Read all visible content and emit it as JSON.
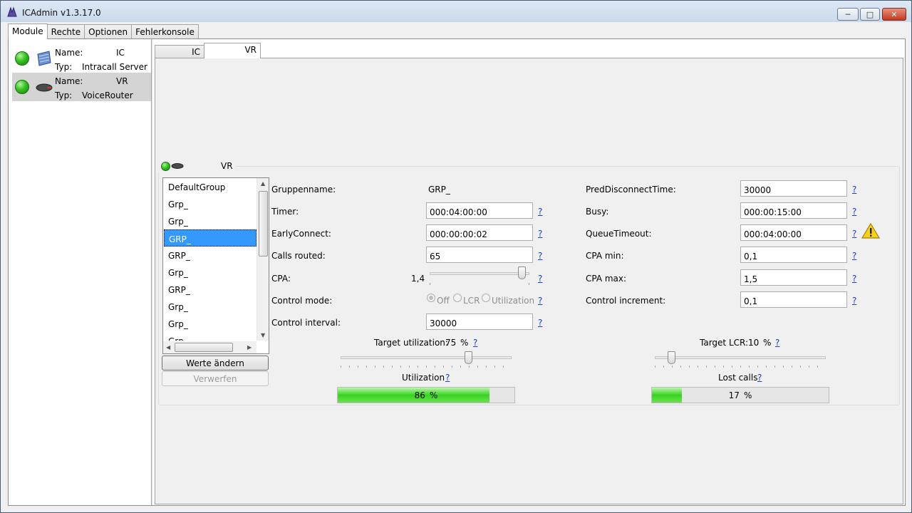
{
  "window": {
    "title": "ICAdmin v1.3.17.0"
  },
  "main_tabs": [
    "Module",
    "Rechte",
    "Optionen",
    "Fehlerkonsole"
  ],
  "modules": [
    {
      "name_label": "Name:",
      "name_value": "IC",
      "type_label": "Typ:",
      "type_value": "Intracall Server"
    },
    {
      "name_label": "Name:",
      "name_value": "VR",
      "type_label": "Typ:",
      "type_value": "VoiceRouter"
    }
  ],
  "sub_tabs": [
    "IC",
    "VR"
  ],
  "group_box": {
    "title": "VR"
  },
  "groups": [
    "DefaultGroup",
    "Grp_",
    "Grp_",
    "GRP_",
    "GRP_",
    "Grp_",
    "GRP_",
    "Grp_",
    "Grp_",
    "Grp_"
  ],
  "buttons": {
    "apply": "Werte ändern",
    "discard": "Verwerfen"
  },
  "help_glyph": "?",
  "form": {
    "gruppenname_label": "Gruppenname:",
    "gruppenname_value": "GRP_",
    "timer_label": "Timer:",
    "timer_value": "000:04:00:00",
    "early_label": "EarlyConnect:",
    "early_value": "000:00:00:02",
    "calls_label": "Calls routed:",
    "calls_value": "65",
    "cpa_label": "CPA:",
    "cpa_value": "1,4",
    "control_mode_label": "Control mode:",
    "control_modes": [
      "Off",
      "LCR",
      "Utilization"
    ],
    "control_interval_label": "Control interval:",
    "control_interval_value": "30000",
    "pred_label": "PredDisconnectTime:",
    "pred_value": "30000",
    "busy_label": "Busy:",
    "busy_value": "000:00:15:00",
    "queue_label": "QueueTimeout:",
    "queue_value": "000:04:00:00",
    "cpa_min_label": "CPA min:",
    "cpa_min_value": "0,1",
    "cpa_max_label": "CPA max:",
    "cpa_max_value": "1,5",
    "cpa_inc_label": "Control increment:",
    "cpa_inc_value": "0,1"
  },
  "target_utilization": {
    "label": "Target utilization:",
    "value": "75",
    "unit": "%"
  },
  "target_lcr": {
    "label": "Target LCR:",
    "value": "10",
    "unit": "%"
  },
  "utilization": {
    "label": "Utilization",
    "value": "86",
    "unit": "%",
    "fraction": 0.86
  },
  "lost_calls": {
    "label": "Lost calls",
    "value": "17",
    "unit": "%",
    "fraction": 0.17
  }
}
